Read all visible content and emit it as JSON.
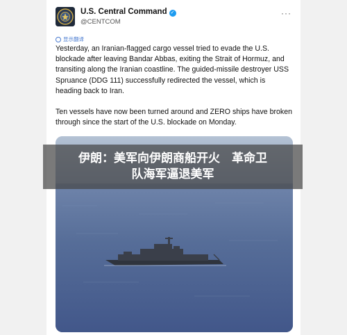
{
  "account": {
    "name": "U.S. Central Command",
    "handle": "@CENTCOM",
    "verified_icon": "verified-badge-icon"
  },
  "translate_label": "显示翻译",
  "tweet": {
    "paragraph1": "Yesterday, an Iranian-flagged cargo vessel tried to evade the U.S. blockade after leaving Bandar Abbas, exiting the Strait of Hormuz, and transiting along the Iranian coastline. The guided-missile destroyer USS Spruance (DDG 111) successfully redirected the vessel, which is heading back to Iran.",
    "paragraph2": "Ten vessels have now been turned around and ZERO ships have broken through since the start of the U.S. blockade on Monday."
  },
  "banner": {
    "line1": "伊朗：美军向伊朗商船开火　革命卫",
    "line2": "队海军逼退美军"
  },
  "colors": {
    "accent": "#1d9bf0",
    "sea": "#4c6290"
  }
}
